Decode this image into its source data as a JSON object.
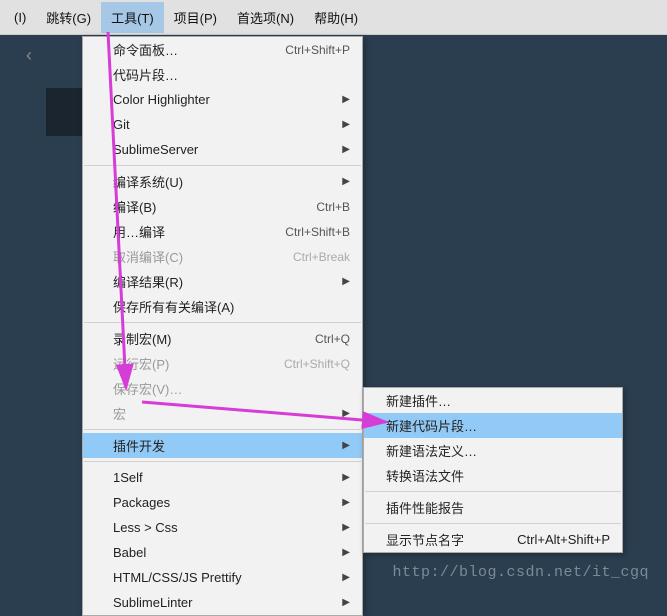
{
  "menubar": {
    "items": [
      {
        "label": "(I)"
      },
      {
        "label": "跳转(G)"
      },
      {
        "label": "工具(T)"
      },
      {
        "label": "项目(P)"
      },
      {
        "label": "首选项(N)"
      },
      {
        "label": "帮助(H)"
      }
    ]
  },
  "dropdown": {
    "groups": [
      [
        {
          "label": "命令面板…",
          "shortcut": "Ctrl+Shift+P"
        },
        {
          "label": "代码片段…"
        },
        {
          "label": "Color Highlighter",
          "arrow": true
        },
        {
          "label": "Git",
          "arrow": true
        },
        {
          "label": "SublimeServer",
          "arrow": true
        }
      ],
      [
        {
          "label": "编译系统(U)",
          "arrow": true
        },
        {
          "label": "编译(B)",
          "shortcut": "Ctrl+B"
        },
        {
          "label": "用…编译",
          "shortcut": "Ctrl+Shift+B"
        },
        {
          "label": "取消编译(C)",
          "shortcut": "Ctrl+Break",
          "disabled": true
        },
        {
          "label": "编译结果(R)",
          "arrow": true
        },
        {
          "label": "保存所有有关编译(A)",
          "checked": true
        }
      ],
      [
        {
          "label": "录制宏(M)",
          "shortcut": "Ctrl+Q"
        },
        {
          "label": "运行宏(P)",
          "shortcut": "Ctrl+Shift+Q",
          "disabled": true
        },
        {
          "label": "保存宏(V)…",
          "disabled": true
        },
        {
          "label": "宏",
          "arrow": true,
          "disabled": true
        }
      ],
      [
        {
          "label": "插件开发",
          "arrow": true,
          "highlighted": true
        }
      ],
      [
        {
          "label": "1Self",
          "arrow": true
        },
        {
          "label": "Packages",
          "arrow": true
        },
        {
          "label": "Less > Css",
          "arrow": true
        },
        {
          "label": "Babel",
          "arrow": true
        },
        {
          "label": "HTML/CSS/JS Prettify",
          "arrow": true
        },
        {
          "label": "SublimeLinter",
          "arrow": true
        }
      ]
    ]
  },
  "submenu": {
    "groups": [
      [
        {
          "label": "新建插件…"
        },
        {
          "label": "新建代码片段…",
          "highlighted": true
        },
        {
          "label": "新建语法定义…"
        },
        {
          "label": "转换语法文件"
        }
      ],
      [
        {
          "label": "插件性能报告"
        }
      ],
      [
        {
          "label": "显示节点名字",
          "shortcut": "Ctrl+Alt+Shift+P"
        }
      ]
    ]
  },
  "watermark": "http://blog.csdn.net/it_cgq",
  "dark_tab": ""
}
